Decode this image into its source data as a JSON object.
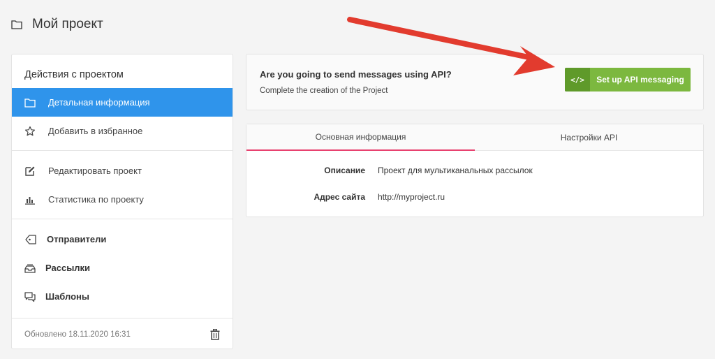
{
  "header": {
    "title": "Мой проект",
    "icon": "folder-icon"
  },
  "sidebar": {
    "heading": "Действия с проектом",
    "items": [
      {
        "label": "Детальная информация",
        "icon": "folder-icon",
        "active": true
      },
      {
        "label": "Добавить в избранное",
        "icon": "star-icon"
      },
      {
        "label": "Редактировать проект",
        "icon": "edit-icon"
      },
      {
        "label": "Статистика по проекту",
        "icon": "bar-chart-icon"
      },
      {
        "label": "Отправители",
        "icon": "tag-icon"
      },
      {
        "label": "Рассылки",
        "icon": "inbox-icon"
      },
      {
        "label": "Шаблоны",
        "icon": "chat-icon"
      }
    ],
    "footer": {
      "updated": "Обновлено 18.11.2020 16:31",
      "trash_icon": "trash-icon"
    }
  },
  "api_banner": {
    "question": "Are you going to send messages using API?",
    "subtitle": "Complete the creation of the Project",
    "button_code": "</>",
    "button_label": "Set up API messaging"
  },
  "tabs": [
    {
      "label": "Основная информация",
      "active": true
    },
    {
      "label": "Настройки API",
      "active": false
    }
  ],
  "details": {
    "description_label": "Описание",
    "description_value": "Проект для мультиканальных рассылок",
    "site_label": "Адрес сайта",
    "site_value": "http://myproject.ru"
  },
  "colors": {
    "active_item": "#2f94eb",
    "button_green": "#7cb83f",
    "button_dark_green": "#5f9a2a",
    "tab_underline": "#e8416f",
    "arrow_red": "#e23b2e"
  }
}
